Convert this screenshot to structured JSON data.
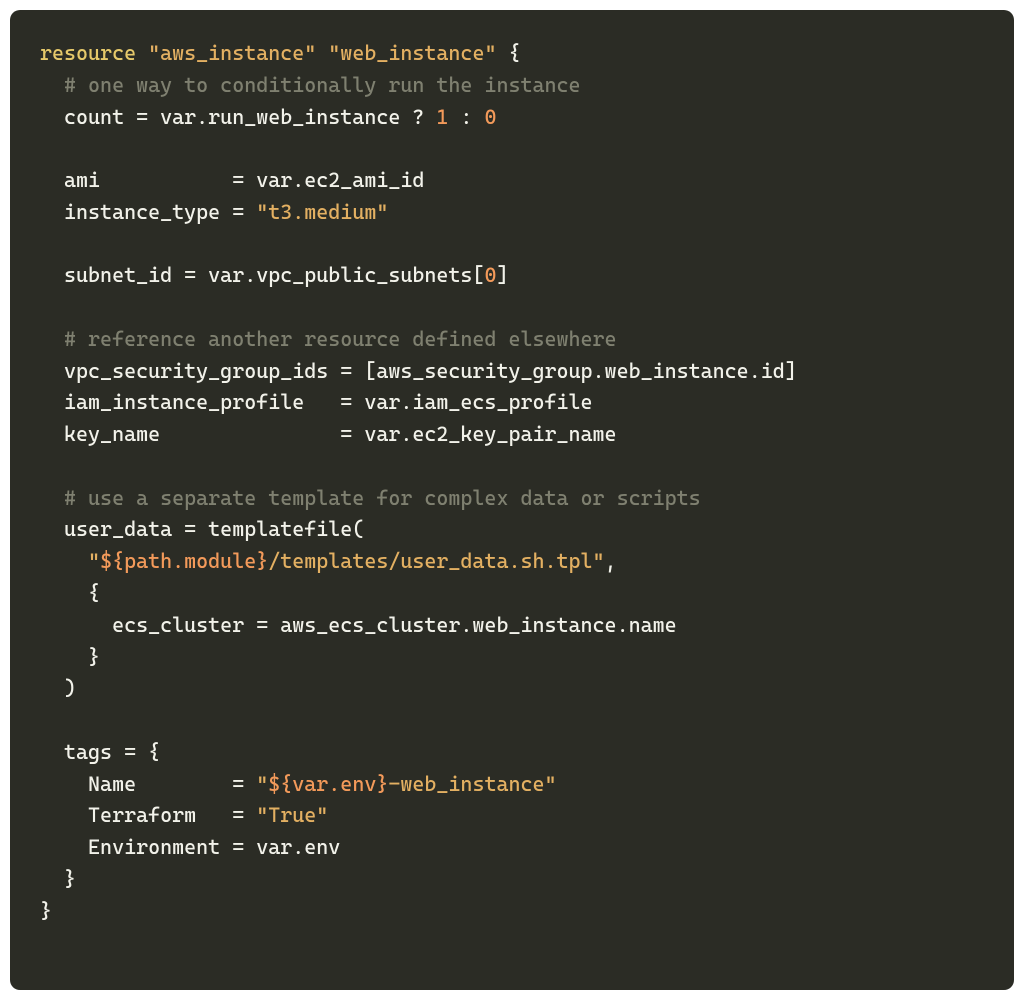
{
  "code": {
    "l1": {
      "kw": "resource",
      "s1": "\"aws_instance\"",
      "s2": "\"web_instance\"",
      "brace": " {"
    },
    "l2_comment": "  # one way to conditionally run the instance",
    "l3": {
      "pre": "  count = var.run_web_instance ? ",
      "n1": "1",
      "mid": " : ",
      "n2": "0"
    },
    "blank": "",
    "l5": "  ami           = var.ec2_ami_id",
    "l6": {
      "pre": "  instance_type = ",
      "str": "\"t3.medium\""
    },
    "l8": {
      "pre": "  subnet_id = var.vpc_public_subnets[",
      "n": "0",
      "post": "]"
    },
    "l10_comment": "  # reference another resource defined elsewhere",
    "l11": "  vpc_security_group_ids = [aws_security_group.web_instance.id]",
    "l12": "  iam_instance_profile   = var.iam_ecs_profile",
    "l13": "  key_name               = var.ec2_key_pair_name",
    "l15_comment": "  # use a separate template for complex data or scripts",
    "l16": "  user_data = templatefile(",
    "l17": {
      "pre": "    ",
      "q1": "\"",
      "interp": "${path.module}",
      "rest": "/templates/user_data.sh.tpl\"",
      "post": ","
    },
    "l18": "    {",
    "l19": "      ecs_cluster = aws_ecs_cluster.web_instance.name",
    "l20": "    }",
    "l21": "  )",
    "l23": "  tags = {",
    "l24": {
      "pre": "    Name        = ",
      "q1": "\"",
      "interp": "${var.env}",
      "rest": "-web_instance\""
    },
    "l25": {
      "pre": "    Terraform   = ",
      "str": "\"True\""
    },
    "l26": "    Environment = var.env",
    "l27": "  }",
    "l28": "}"
  }
}
